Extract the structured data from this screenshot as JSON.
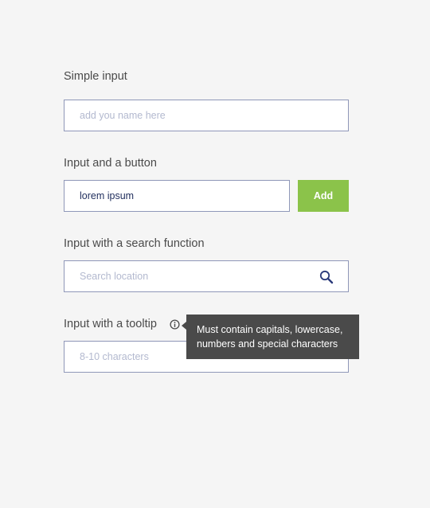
{
  "simple_input": {
    "label": "Simple input",
    "placeholder": "add you name here"
  },
  "input_button": {
    "label": "Input and a button",
    "value": "lorem ipsum",
    "button_label": "Add",
    "button_color": "#8bc34a"
  },
  "search_input": {
    "label": "Input with a search function",
    "placeholder": "Search location",
    "icon": "search-icon"
  },
  "tooltip_input": {
    "label": "Input with a tooltip",
    "icon": "info-icon",
    "placeholder": "8-10 characters",
    "tooltip": {
      "line1": "Must contain capitals, lowercase,",
      "line2": "numbers and special characters"
    }
  },
  "colors": {
    "background": "#f5f5f5",
    "border": "#8f97b8",
    "accent": "#8bc34a",
    "tooltip_bg": "#4a4a4a"
  }
}
